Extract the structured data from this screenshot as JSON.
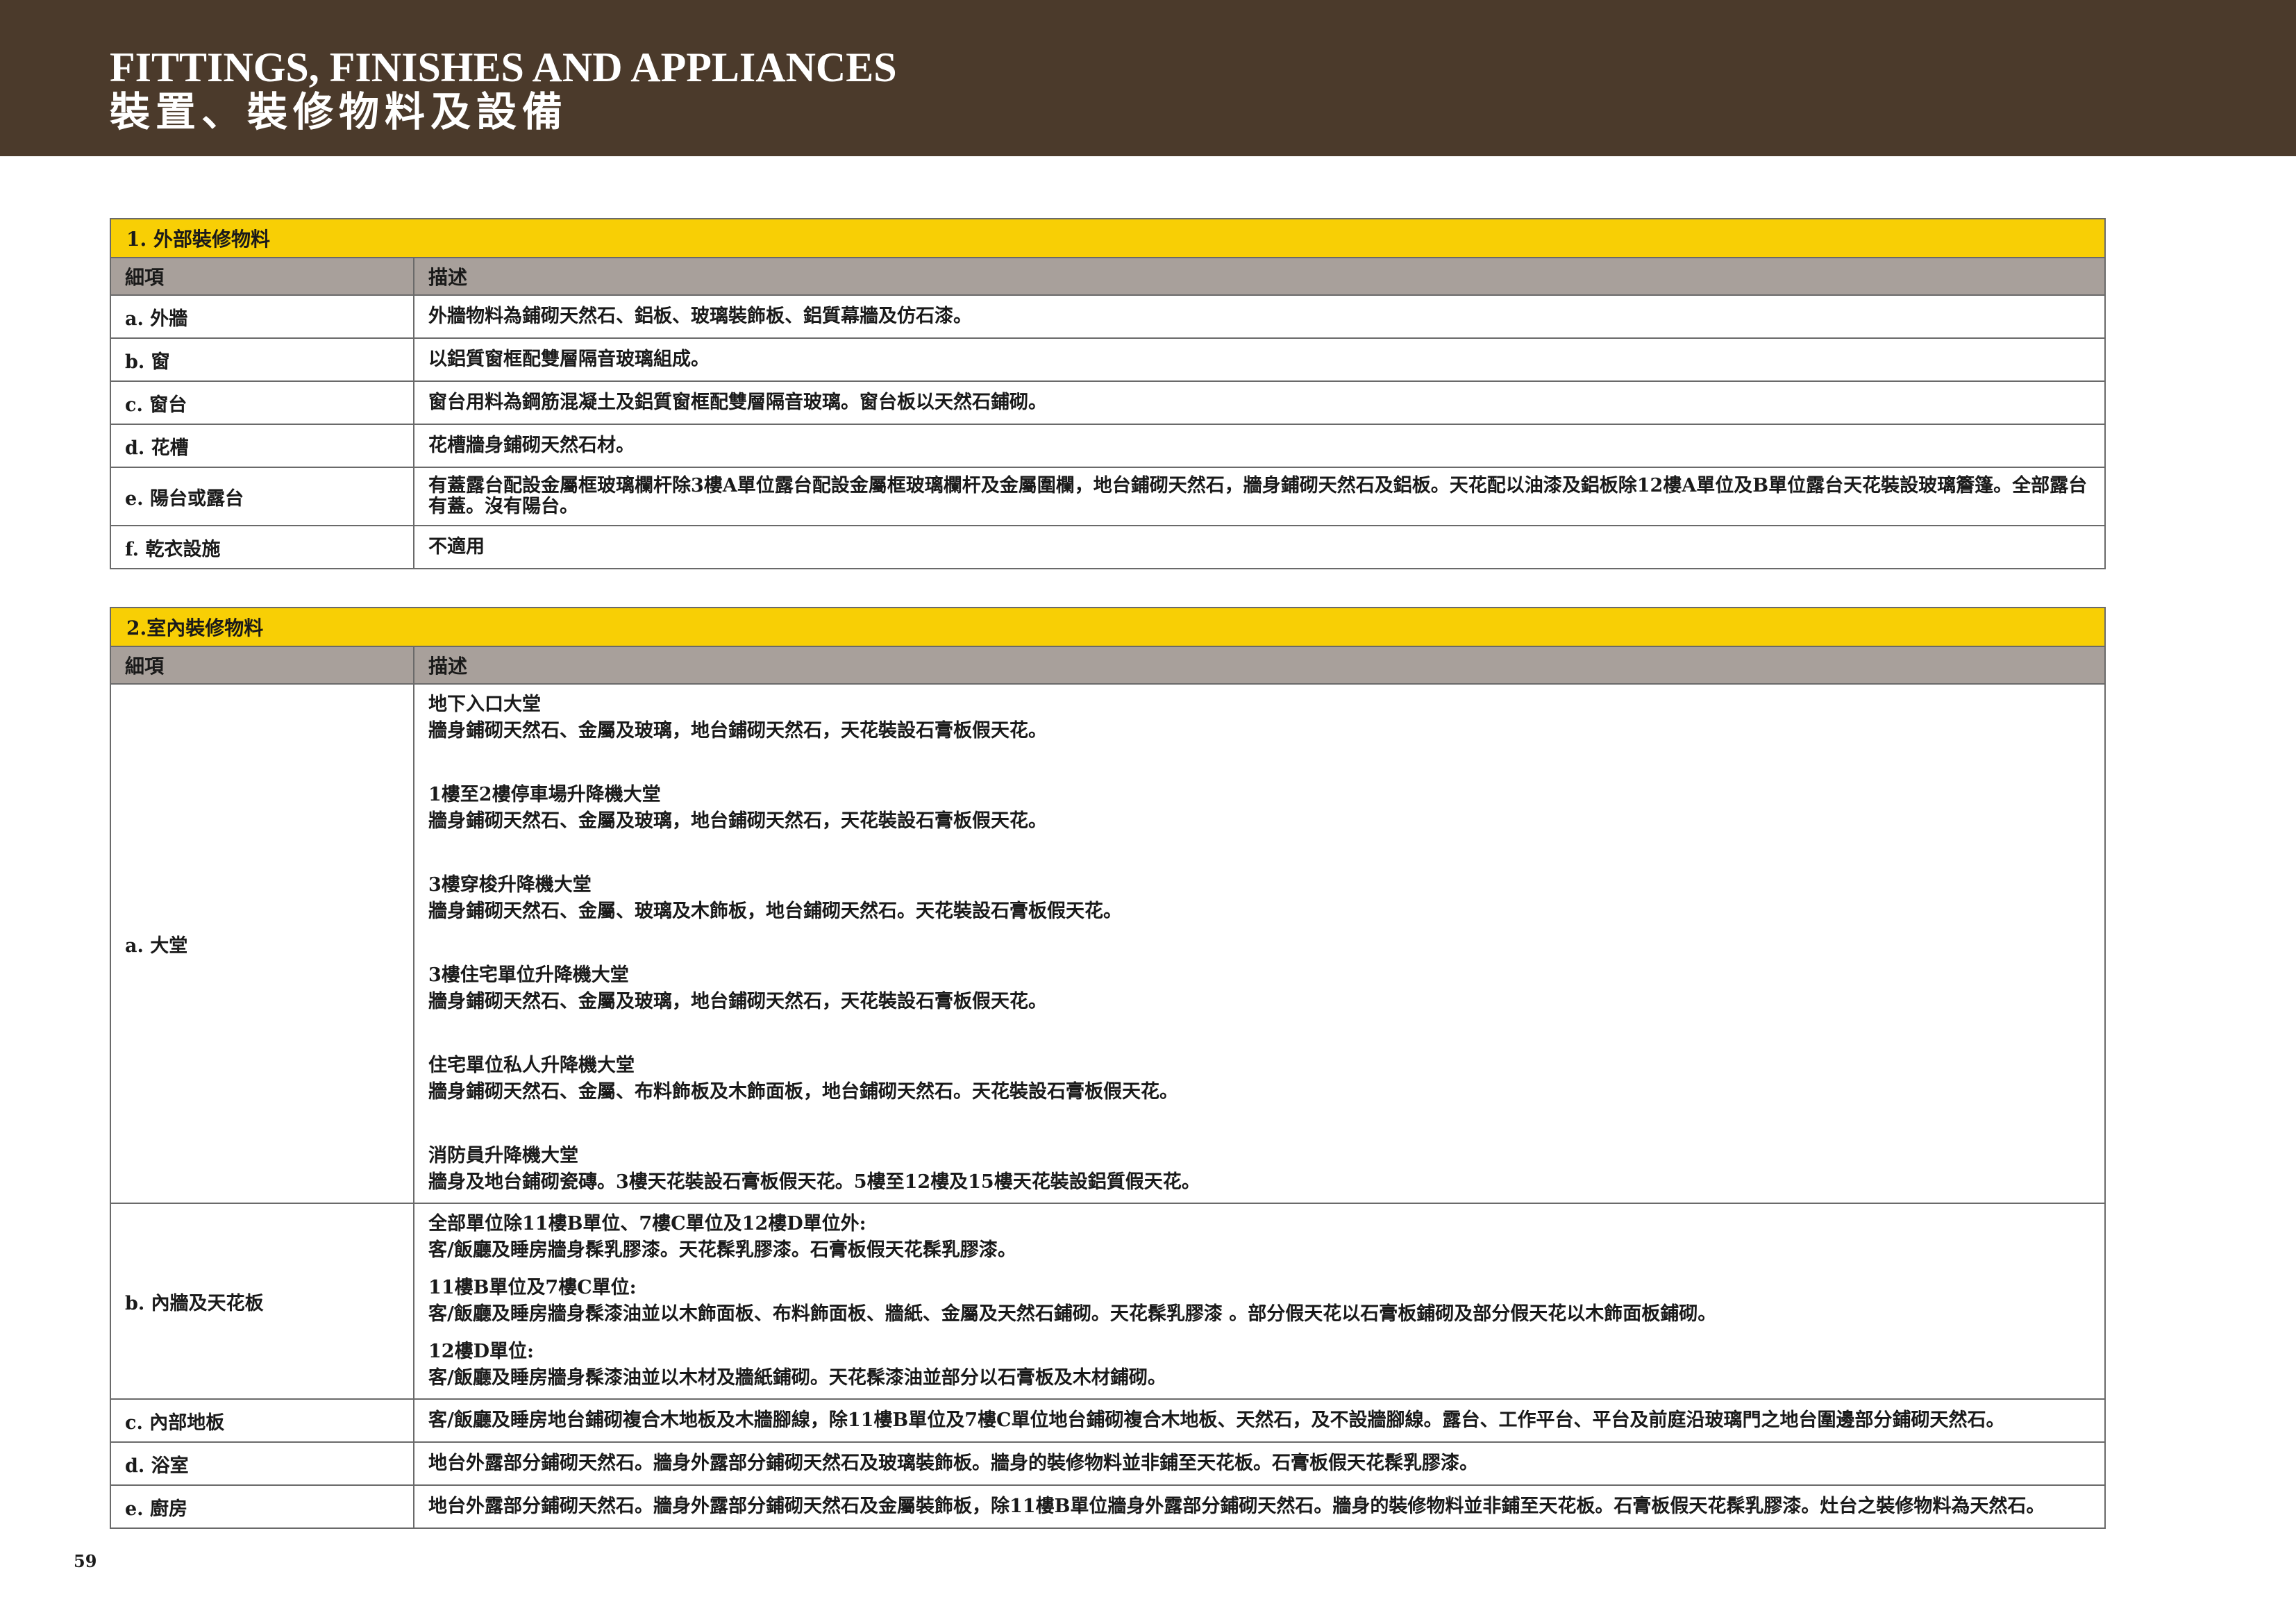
{
  "header": {
    "title_en": "FITTINGS, FINISHES AND APPLIANCES",
    "title_zh": "裝置、裝修物料及設備"
  },
  "colors": {
    "header_bg": "#4b3a2b",
    "section_bg": "#f8cf05",
    "column_head_bg": "#a8a09b"
  },
  "exterior": {
    "section_title": "1. 外部裝修物料",
    "col_item": "細項",
    "col_desc": "描述",
    "rows": [
      {
        "item": "a. 外牆",
        "desc": "外牆物料為鋪砌天然石、鋁板、玻璃裝飾板、鋁質幕牆及仿石漆。"
      },
      {
        "item": "b. 窗",
        "desc": "以鋁質窗框配雙層隔音玻璃組成。"
      },
      {
        "item": "c. 窗台",
        "desc": "窗台用料為鋼筋混凝土及鋁質窗框配雙層隔音玻璃。窗台板以天然石鋪砌。"
      },
      {
        "item": "d. 花槽",
        "desc": "花槽牆身鋪砌天然石材。"
      },
      {
        "item": "e. 陽台或露台",
        "desc": "有蓋露台配設金屬框玻璃欄杆除3樓A單位露台配設金屬框玻璃欄杆及金屬圍欄，地台鋪砌天然石，牆身鋪砌天然石及鋁板。天花配以油漆及鋁板除12樓A單位及B單位露台天花裝設玻璃簷篷。全部露台有蓋。沒有陽台。"
      },
      {
        "item": "f. 乾衣設施",
        "desc": "不適用"
      }
    ]
  },
  "interior": {
    "section_title": "2.室內裝修物料",
    "col_item": "細項",
    "col_desc": "描述",
    "lobby": {
      "item": "a. 大堂",
      "blocks": [
        {
          "title": "地下入口大堂",
          "text": "牆身鋪砌天然石、金屬及玻璃，地台鋪砌天然石，天花裝設石膏板假天花。"
        },
        {
          "title": "1樓至2樓停車場升降機大堂",
          "text": "牆身鋪砌天然石、金屬及玻璃，地台鋪砌天然石，天花裝設石膏板假天花。"
        },
        {
          "title": "3樓穿梭升降機大堂",
          "text": "牆身鋪砌天然石、金屬、玻璃及木飾板，地台鋪砌天然石。天花裝設石膏板假天花。"
        },
        {
          "title": "3樓住宅單位升降機大堂",
          "text": "牆身鋪砌天然石、金屬及玻璃，地台鋪砌天然石，天花裝設石膏板假天花。"
        },
        {
          "title": "住宅單位私人升降機大堂",
          "text": "牆身鋪砌天然石、金屬、布料飾板及木飾面板，地台鋪砌天然石。天花裝設石膏板假天花。"
        },
        {
          "title": "消防員升降機大堂",
          "text": "牆身及地台鋪砌瓷磚。3樓天花裝設石膏板假天花。5樓至12樓及15樓天花裝設鋁質假天花。"
        }
      ]
    },
    "walls": {
      "item": "b. 內牆及天花板",
      "blocks": [
        {
          "title": "全部單位除11樓B單位、7樓C單位及12樓D單位外:",
          "text": "客/飯廳及睡房牆身髹乳膠漆。天花髹乳膠漆。石膏板假天花髹乳膠漆。"
        },
        {
          "title": "11樓B單位及7樓C單位:",
          "text": "客/飯廳及睡房牆身髹漆油並以木飾面板、布料飾面板、牆紙、金屬及天然石鋪砌。天花髹乳膠漆 。部分假天花以石膏板鋪砌及部分假天花以木飾面板鋪砌。"
        },
        {
          "title": "12樓D單位:",
          "text": "客/飯廳及睡房牆身髹漆油並以木材及牆紙鋪砌。天花髹漆油並部分以石膏板及木材鋪砌。"
        }
      ]
    },
    "rows": [
      {
        "item": "c. 內部地板",
        "desc": "客/飯廳及睡房地台鋪砌複合木地板及木牆腳線，除11樓B單位及7樓C單位地台鋪砌複合木地板、天然石，及不設牆腳線。露台、工作平台、平台及前庭沿玻璃門之地台圍邊部分鋪砌天然石。"
      },
      {
        "item": "d. 浴室",
        "desc": "地台外露部分鋪砌天然石。牆身外露部分鋪砌天然石及玻璃裝飾板。牆身的裝修物料並非鋪至天花板。石膏板假天花髹乳膠漆。"
      },
      {
        "item": "e. 廚房",
        "desc": "地台外露部分鋪砌天然石。牆身外露部分鋪砌天然石及金屬裝飾板，除11樓B單位牆身外露部分鋪砌天然石。牆身的裝修物料並非鋪至天花板。石膏板假天花髹乳膠漆。灶台之裝修物料為天然石。"
      }
    ]
  },
  "page_number": "59"
}
